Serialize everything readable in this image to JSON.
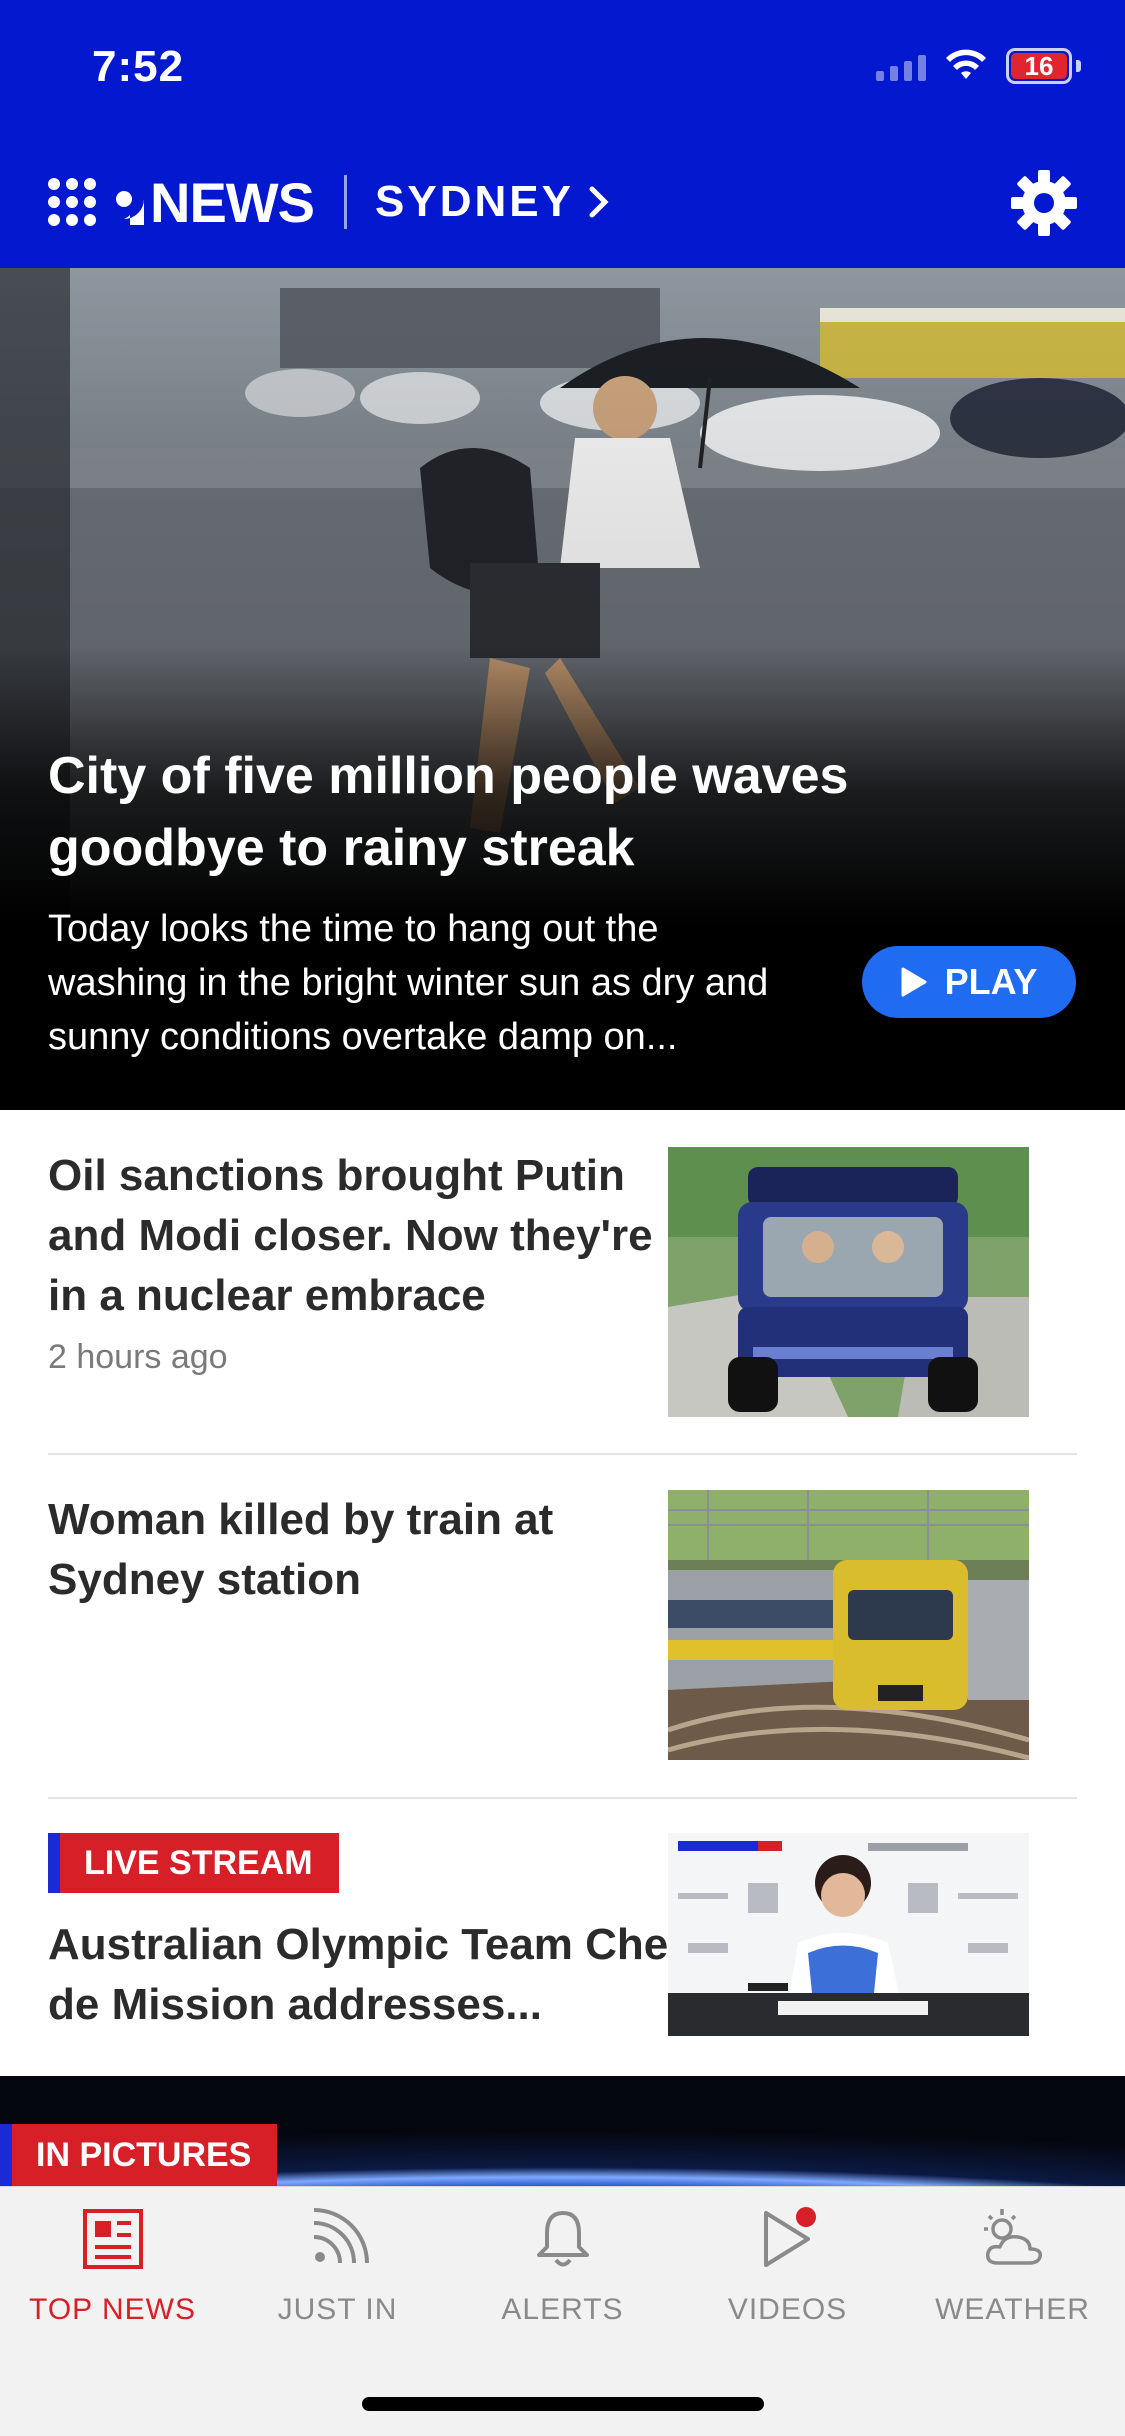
{
  "status_bar": {
    "time": "7:52",
    "battery_level": "16"
  },
  "header": {
    "brand": "NEWS",
    "location": "SYDNEY"
  },
  "hero": {
    "title": "City of five million people waves goodbye to rainy streak",
    "summary": "Today looks the time to hang out the washing in the bright winter sun as dry and sunny conditions overtake damp on...",
    "play_label": "PLAY"
  },
  "stories": [
    {
      "title": "Oil sanctions brought Putin and Modi closer. Now they're in a nuclear embrace",
      "time": "2 hours ago"
    },
    {
      "title": "Woman killed by train at Sydney station"
    },
    {
      "tag": "LIVE STREAM",
      "title": "Australian Olympic Team Chef de Mission addresses..."
    }
  ],
  "in_pictures": {
    "tag": "IN PICTURES"
  },
  "tabbar": {
    "tabs": [
      {
        "label": "TOP NEWS",
        "icon": "newspaper-icon",
        "active": true
      },
      {
        "label": "JUST IN",
        "icon": "rss-icon"
      },
      {
        "label": "ALERTS",
        "icon": "bell-icon"
      },
      {
        "label": "VIDEOS",
        "icon": "video-play-icon"
      },
      {
        "label": "WEATHER",
        "icon": "sun-cloud-icon"
      }
    ]
  },
  "colors": {
    "brand_blue": "#0418CF",
    "accent_red": "#D61F26",
    "play_blue": "#1F6BF2"
  }
}
